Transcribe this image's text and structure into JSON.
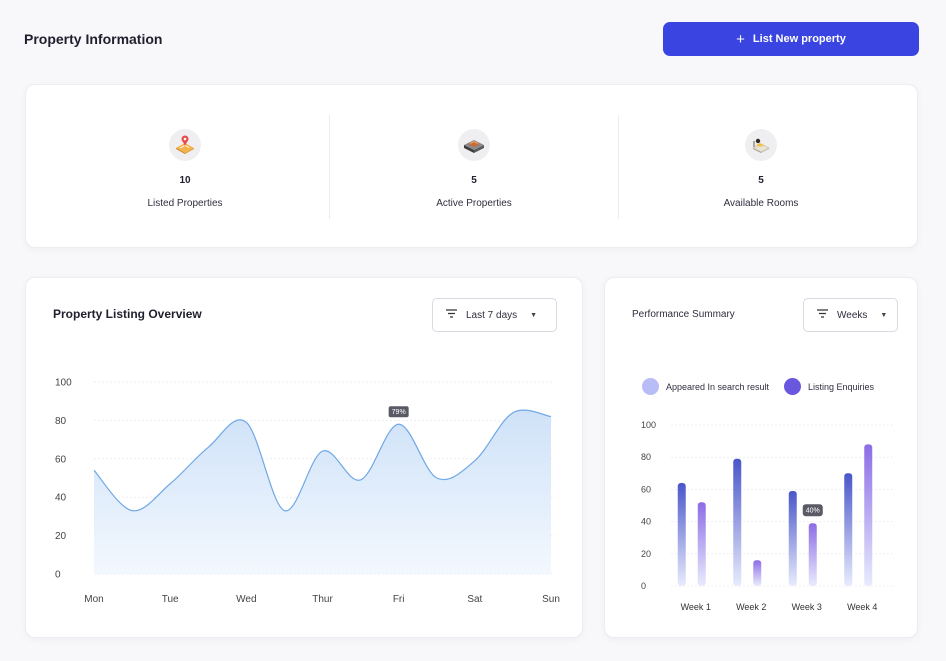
{
  "header": {
    "title": "Property Information",
    "cta_label": "List New property"
  },
  "stats": [
    {
      "value": "10",
      "label": "Listed Properties",
      "icon": "map-pin-property-icon"
    },
    {
      "value": "5",
      "label": "Active Properties",
      "icon": "sofa-property-icon"
    },
    {
      "value": "5",
      "label": "Available Rooms",
      "icon": "bed-room-icon"
    }
  ],
  "overview": {
    "title": "Property Listing Overview",
    "filter_label": "Last 7 days",
    "tooltip": "79%"
  },
  "performance": {
    "title": "Performance Summary",
    "filter_label": "Weeks",
    "tooltip": "40%"
  },
  "chart_data": [
    {
      "type": "area",
      "title": "Property Listing Overview",
      "categories": [
        "Mon",
        "Tue",
        "Wed",
        "Thur",
        "Fri",
        "Sat",
        "Sun"
      ],
      "x": [
        0,
        0.5,
        1,
        1.5,
        2,
        2.5,
        3,
        3.5,
        4,
        4.5,
        5,
        5.5,
        6
      ],
      "values": [
        54,
        33,
        47,
        66,
        79,
        33,
        64,
        49,
        78,
        50,
        59,
        84,
        82
      ],
      "ylim": [
        0,
        100
      ],
      "yticks": [
        0,
        20,
        40,
        60,
        80,
        100
      ],
      "grid": true,
      "annotation": {
        "x": "Fri",
        "label": "79%"
      },
      "colors": {
        "line": "#6fa8e6",
        "fill_top": "#cfe2f8",
        "fill_bottom": "#f3f8fe"
      }
    },
    {
      "type": "bar",
      "title": "Performance Summary",
      "categories": [
        "Week 1",
        "Week 2",
        "Week 3",
        "Week 4"
      ],
      "series": [
        {
          "name": "Appeared In search result",
          "values": [
            64,
            79,
            59,
            70
          ],
          "color": "#4a56c9"
        },
        {
          "name": "Listing Enquiries",
          "values": [
            52,
            16,
            39,
            88
          ],
          "color": "#8d6ce6"
        }
      ],
      "ylim": [
        0,
        100
      ],
      "yticks": [
        0,
        20,
        40,
        60,
        80,
        100
      ],
      "grid": true,
      "legend": "top",
      "legend_colors": [
        "#b9bdf7",
        "#6a57e0"
      ],
      "annotation": {
        "category": "Week 3",
        "series": 1,
        "label": "40%"
      }
    }
  ]
}
